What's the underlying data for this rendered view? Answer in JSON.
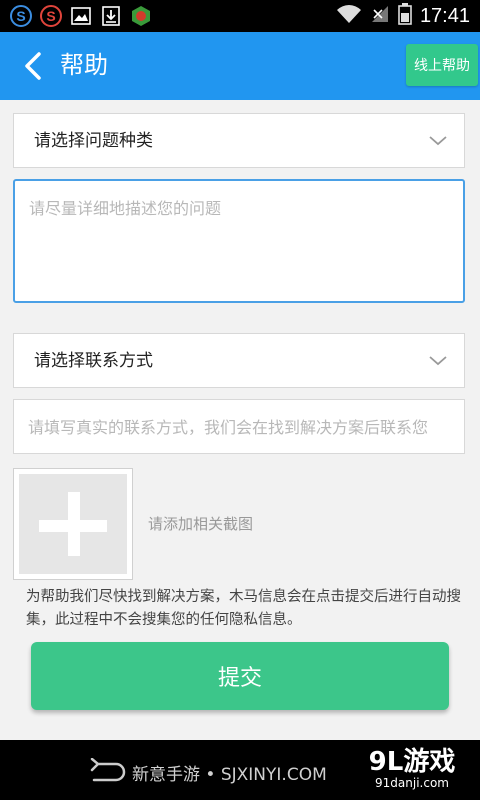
{
  "status_bar": {
    "time": "17:41",
    "left_icons": [
      "s-app-icon-blue",
      "s-app-icon-red",
      "gallery-icon",
      "download-icon",
      "game-app-icon"
    ],
    "right_icons": [
      "wifi-icon",
      "no-signal-icon",
      "battery-icon"
    ]
  },
  "header": {
    "back_icon": "chevron-left-icon",
    "title": "帮助",
    "online_help": "线上帮助"
  },
  "form": {
    "category_select": "请选择问题种类",
    "description_placeholder": "请尽量详细地描述您的问题",
    "contact_select": "请选择联系方式",
    "contact_placeholder": "请填写真实的联系方式，我们会在找到解决方案后联系您",
    "add_screenshot": "请添加相关截图",
    "notice": "为帮助我们尽快找到解决方案，木马信息会在点击提交后进行自动搜集，此过程中不会搜集您的任何隐私信息。",
    "submit": "提交"
  },
  "nav_bar": {
    "watermark": "新意手游 • SJXINYI.COM",
    "logo_main": "9L游戏",
    "logo_sub": "91danji.com"
  },
  "colors": {
    "header": "#2196f0",
    "accent_green": "#3cc68a",
    "online_help_bg": "#32c88c",
    "textarea_border": "#4aa0e6"
  }
}
